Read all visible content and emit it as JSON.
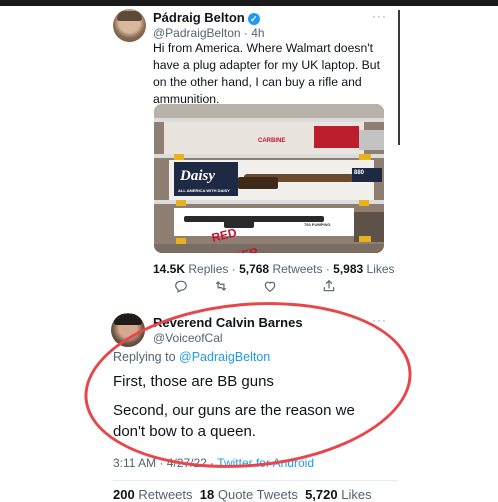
{
  "tweet1": {
    "name": "Pádraig Belton",
    "verified_icon": "verified-badge-icon",
    "handle": "@PadraigBelton",
    "time": "4h",
    "more": "···",
    "text": "Hi from America. Where Walmart doesn't have a plug adapter for my UK laptop. But on the other hand, I can buy a rifle and ammunition.",
    "photo": {
      "signs": [
        "RED RYDER",
        "CARBINE",
        "Daisy",
        "880",
        "ALL AMERICA WITH DAISY",
        "753 PUMPING"
      ]
    },
    "stats": {
      "replies": "14.5K",
      "replies_label": "Replies",
      "retweets": "5,768",
      "retweets_label": "Retweets",
      "likes": "5,983",
      "likes_label": "Likes"
    },
    "actions": [
      "reply-icon",
      "retweet-icon",
      "like-icon",
      "share-icon"
    ]
  },
  "tweet2": {
    "name": "Reverend Calvin Barnes",
    "handle": "@VoiceofCal",
    "more": "···",
    "replying_prefix": "Replying to",
    "replying_to": "@PadraigBelton",
    "line1": "First, those are BB guns",
    "line2a": "Second, our guns are the reason we",
    "line2b": "don't bow to a queen.",
    "time": "3:11 AM · 4/27/22 · ",
    "source": "Twitter for Android",
    "stats": {
      "retweets": "200",
      "retweets_label": "Retweets",
      "quotes": "18",
      "quotes_label": "Quote Tweets",
      "likes": "5,720",
      "likes_label": "Likes"
    }
  },
  "colors": {
    "link": "#1d9bf0",
    "annotation": "#e8464a",
    "muted": "#536471"
  }
}
